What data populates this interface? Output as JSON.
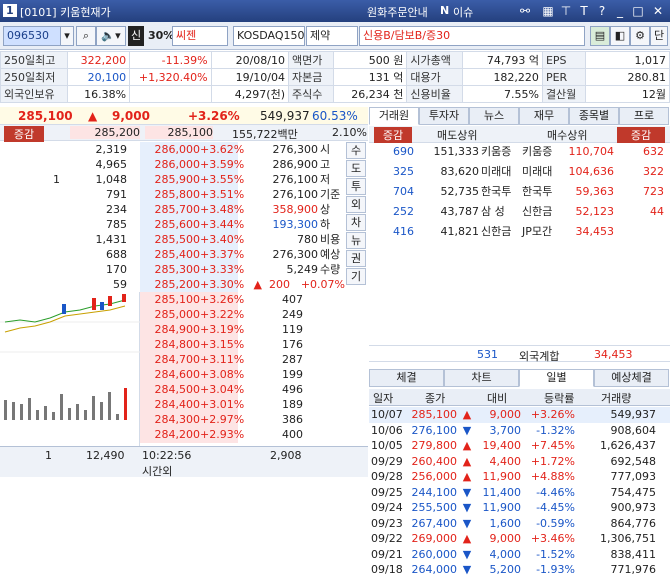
{
  "window": {
    "num": "1",
    "title": "[0101] 키움현재가",
    "notice": "원화주문안내",
    "issue": "이슈"
  },
  "toolbar": {
    "code": "096530",
    "name": "씨젠",
    "badge_sin": "신",
    "margin": "30%",
    "index": "KOSDAQ150",
    "sector": "제약",
    "credit": "신용B/담보B/증30",
    "right_btn": "단"
  },
  "info": [
    [
      "250일최고",
      "322,200",
      "-11.39%",
      "20/08/10",
      "액면가",
      "500 원",
      "시가총액",
      "74,793 억",
      "EPS",
      "1,017"
    ],
    [
      "250일최저",
      "20,100",
      "+1,320.40%",
      "19/10/04",
      "자본금",
      "131 억",
      "대용가",
      "182,220",
      "PER",
      "280.81"
    ],
    [
      "외국인보유",
      "16.38%",
      "",
      "4,297(천)",
      "주식수",
      "26,234 천",
      "신용비율",
      "7.55%",
      "결산월",
      "12월"
    ]
  ],
  "price": {
    "current": "285,100",
    "arrow": "▲",
    "change": "9,000",
    "rate": "+3.26%",
    "volume": "549,937",
    "vol_rate": "60.53%",
    "label": "증감",
    "pre1": "285,200",
    "pre2": "285,100",
    "amount": "155,722백만",
    "turn": "2.10%"
  },
  "ask": [
    [
      "",
      "2,319",
      "286,000",
      "+3.62%"
    ],
    [
      "",
      "4,965",
      "286,000",
      "+3.59%"
    ],
    [
      "1",
      "1,048",
      "285,900",
      "+3.55%"
    ],
    [
      "",
      "791",
      "285,800",
      "+3.51%"
    ],
    [
      "",
      "234",
      "285,700",
      "+3.48%"
    ],
    [
      "",
      "785",
      "285,600",
      "+3.44%"
    ],
    [
      "",
      "1,431",
      "285,500",
      "+3.40%"
    ],
    [
      "",
      "688",
      "285,400",
      "+3.37%"
    ],
    [
      "",
      "170",
      "285,300",
      "+3.33%"
    ],
    [
      "",
      "59",
      "285,200",
      "+3.30%"
    ]
  ],
  "bid": [
    [
      "285,100",
      "+3.26%",
      "407"
    ],
    [
      "285,000",
      "+3.22%",
      "249"
    ],
    [
      "284,900",
      "+3.19%",
      "119"
    ],
    [
      "284,800",
      "+3.15%",
      "176"
    ],
    [
      "284,700",
      "+3.11%",
      "287"
    ],
    [
      "284,600",
      "+3.08%",
      "199"
    ],
    [
      "284,500",
      "+3.04%",
      "496"
    ],
    [
      "284,400",
      "+3.01%",
      "189"
    ],
    [
      "284,300",
      "+2.97%",
      "386"
    ],
    [
      "284,200",
      "+2.93%",
      "400"
    ]
  ],
  "summary": [
    [
      "276,300",
      "시"
    ],
    [
      "286,900",
      "고"
    ],
    [
      "276,100",
      "저"
    ],
    [
      "276,100",
      "기준"
    ],
    [
      "358,900",
      "상"
    ],
    [
      "193,300",
      "하"
    ],
    [
      "780",
      "비용"
    ],
    [
      "276,300",
      "예상"
    ],
    [
      "5,249",
      "수량"
    ]
  ],
  "expect": {
    "arrow": "▲",
    "change": "200",
    "rate": "+0.07%"
  },
  "vert_tabs": [
    "수",
    "도",
    "투",
    "외",
    "차",
    "뉴",
    "권",
    "기"
  ],
  "ob_footer": {
    "cnt": "1",
    "total_ask": "12,490",
    "time": "10:22:56",
    "afterhours": "시간외",
    "total_bid": "2,908"
  },
  "right_tabs": [
    "거래원",
    "투자자",
    "뉴스",
    "재무",
    "종목별",
    "프로"
  ],
  "broker_head": [
    "증감",
    "매도상위",
    "매수상위",
    "증감"
  ],
  "brokers": [
    [
      "690",
      "151,333",
      "키움증",
      "키움증",
      "110,704",
      "632"
    ],
    [
      "325",
      "83,620",
      "미래대",
      "미래대",
      "104,636",
      "322"
    ],
    [
      "704",
      "52,735",
      "한국투",
      "한국투",
      "59,363",
      "723"
    ],
    [
      "252",
      "43,787",
      "삼 성",
      "신한금",
      "52,123",
      "44"
    ],
    [
      "416",
      "41,821",
      "신한금",
      "JP모간",
      "34,453",
      ""
    ]
  ],
  "broker_foreign": {
    "left": "531",
    "label": "외국계합",
    "right": "34,453"
  },
  "bottom_tabs": [
    "체결",
    "차트",
    "일별",
    "예상체결"
  ],
  "daily_head": [
    "일자",
    "종가",
    "대비",
    "등락률",
    "거래량"
  ],
  "daily": [
    [
      "10/07",
      "285,100",
      "▲",
      "9,000",
      "+3.26%",
      "549,937",
      "up"
    ],
    [
      "10/06",
      "276,100",
      "▼",
      "3,700",
      "-1.32%",
      "908,604",
      "down"
    ],
    [
      "10/05",
      "279,800",
      "▲",
      "19,400",
      "+7.45%",
      "1,626,437",
      "up"
    ],
    [
      "09/29",
      "260,400",
      "▲",
      "4,400",
      "+1.72%",
      "692,548",
      "up"
    ],
    [
      "09/28",
      "256,000",
      "▲",
      "11,900",
      "+4.88%",
      "777,093",
      "up"
    ],
    [
      "09/25",
      "244,100",
      "▼",
      "11,400",
      "-4.46%",
      "754,475",
      "down"
    ],
    [
      "09/24",
      "255,500",
      "▼",
      "11,900",
      "-4.45%",
      "900,973",
      "down"
    ],
    [
      "09/23",
      "267,400",
      "▼",
      "1,600",
      "-0.59%",
      "864,776",
      "down"
    ],
    [
      "09/22",
      "269,000",
      "▲",
      "9,000",
      "+3.46%",
      "1,306,751",
      "up"
    ],
    [
      "09/21",
      "260,000",
      "▼",
      "4,000",
      "-1.52%",
      "838,411",
      "down"
    ],
    [
      "09/18",
      "264,000",
      "▼",
      "5,200",
      "-1.93%",
      "771,976",
      "down"
    ]
  ],
  "colors": {
    "up": "#e2231a",
    "down": "#1a56c7",
    "header": "#2a4686"
  }
}
